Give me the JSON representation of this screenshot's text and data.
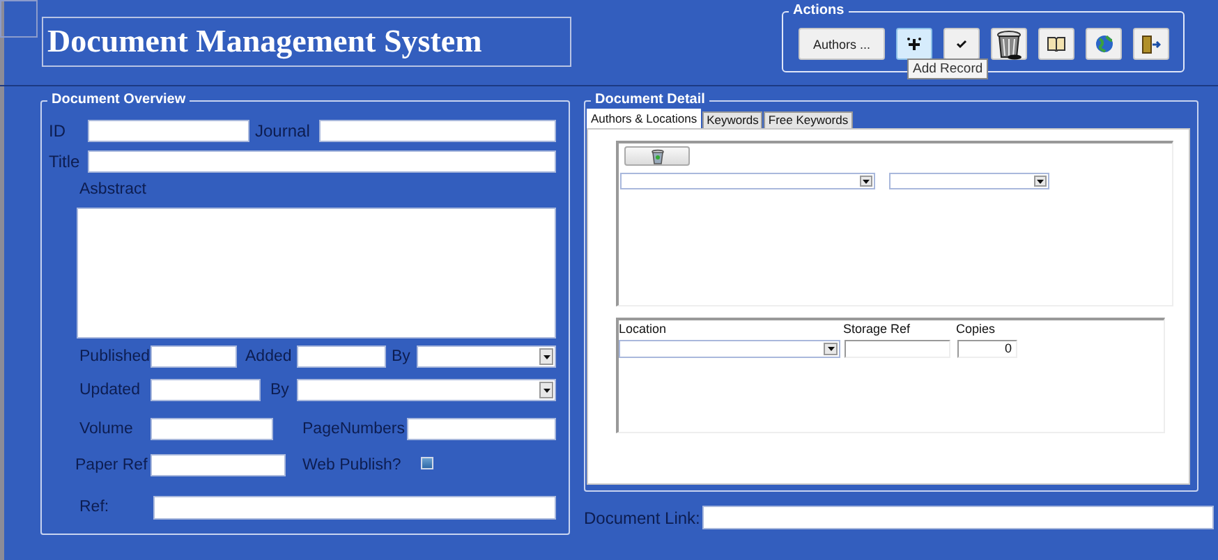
{
  "window": {
    "title": "Document Management System"
  },
  "actions": {
    "label": "Actions",
    "tooltip": "Add Record",
    "buttons": [
      {
        "kind": "text",
        "label": "Authors ...",
        "highlighted": false
      },
      {
        "kind": "add",
        "highlighted": true
      },
      {
        "kind": "check",
        "highlighted": false
      },
      {
        "kind": "trash",
        "highlighted": false
      },
      {
        "kind": "book",
        "highlighted": false
      },
      {
        "kind": "globe",
        "highlighted": false
      },
      {
        "kind": "exit",
        "highlighted": false
      }
    ]
  },
  "overview": {
    "label": "Document Overview",
    "rows": [
      [
        {
          "kind": "text",
          "label": "ID"
        },
        {
          "kind": "text",
          "label": "Journal"
        }
      ],
      [
        {
          "kind": "text",
          "label": "Title"
        }
      ],
      [
        {
          "kind": "memo",
          "label": "Asbstract"
        }
      ],
      [
        {
          "kind": "text",
          "label": "Published"
        },
        {
          "kind": "text",
          "label": "Added"
        },
        {
          "kind": "dropdown",
          "label": "By"
        }
      ],
      [
        {
          "kind": "text",
          "label": "Updated"
        },
        {
          "kind": "dropdown",
          "label": "By"
        }
      ],
      [
        {
          "kind": "text",
          "label": "Volume"
        },
        {
          "kind": "text",
          "label": "PageNumbers"
        }
      ],
      [
        {
          "kind": "text",
          "label": "Paper Ref"
        },
        {
          "kind": "checkbox",
          "label": "Web Publish?",
          "checked": false
        }
      ],
      [
        {
          "kind": "text",
          "label": "Ref:"
        }
      ]
    ]
  },
  "detail": {
    "label": "Document Detail",
    "tabs": [
      {
        "label": "Authors & Locations",
        "selected": true
      },
      {
        "label": "Keywords",
        "selected": false
      },
      {
        "label": "Free Keywords",
        "selected": false
      }
    ],
    "authors": {
      "buttons": [
        {
          "kind": "bin"
        }
      ],
      "fields": [
        {
          "kind": "dropdown"
        },
        {
          "kind": "dropdown"
        }
      ]
    },
    "locations": {
      "columns": [
        "Location",
        "Storage Ref",
        "Copies"
      ],
      "rows": [
        [
          {
            "kind": "dropdown"
          },
          {
            "kind": "text"
          },
          {
            "kind": "number",
            "value": "0"
          }
        ]
      ]
    }
  },
  "document_link": {
    "label": "Document Link:"
  }
}
